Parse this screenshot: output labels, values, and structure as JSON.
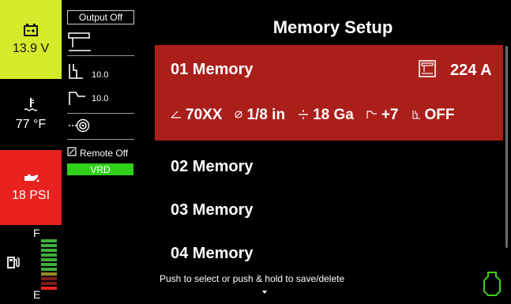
{
  "status": {
    "battery": {
      "value": "13.9 V",
      "icon": "battery-icon",
      "color": "#d5ea2a"
    },
    "temperature": {
      "value": "77 °F",
      "icon": "coolant-temp-icon"
    },
    "oil": {
      "value": "18 PSI",
      "icon": "oil-can-icon",
      "color": "#e8231f"
    },
    "fuel": {
      "full_label": "F",
      "empty_label": "E",
      "icon": "fuel-pump-icon"
    }
  },
  "process": {
    "output_label": "Output Off",
    "arc_force_value": "10.0",
    "hot_start_value": "10.0",
    "remote_label": "Remote Off",
    "vrd_label": "VRD",
    "vrd_color": "#2fd11a"
  },
  "main": {
    "title": "Memory Setup",
    "memories": [
      {
        "name": "01 Memory",
        "amperage": "224 A",
        "electrode": "70XX",
        "diameter": "1/8 in",
        "gauge": "18 Ga",
        "arc": "+7",
        "hot_start": "OFF",
        "selected": true
      },
      {
        "name": "02 Memory"
      },
      {
        "name": "03 Memory"
      },
      {
        "name": "04 Memory"
      }
    ],
    "hint": "Push to select or push & hold to save/delete",
    "accent_color": "#ab1f1b"
  }
}
